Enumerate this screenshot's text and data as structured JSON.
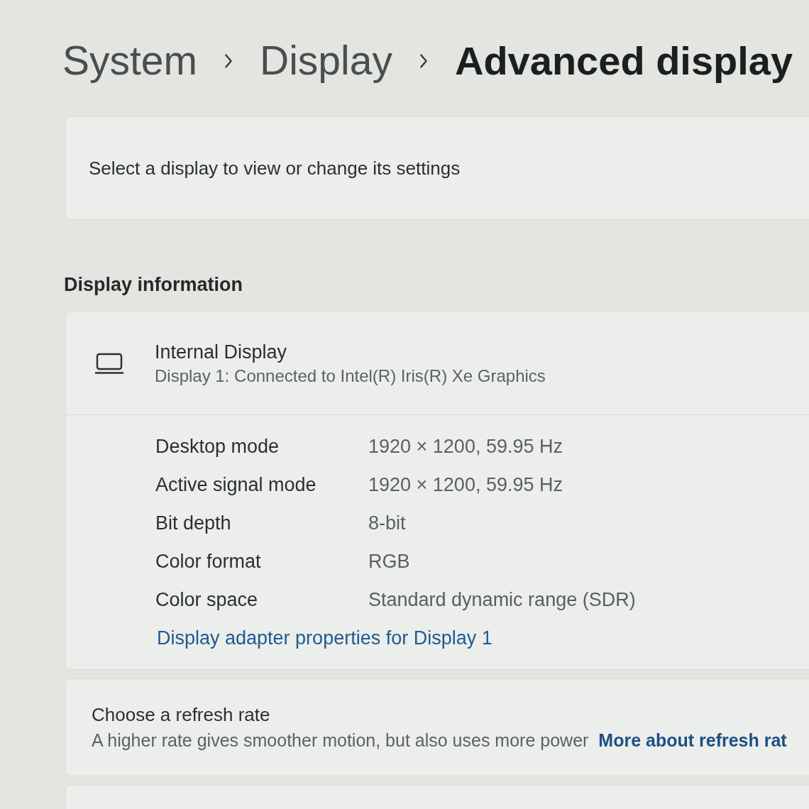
{
  "breadcrumb": [
    {
      "label": "System",
      "current": false
    },
    {
      "label": "Display",
      "current": false
    },
    {
      "label": "Advanced display",
      "current": true
    }
  ],
  "display_select": {
    "prompt": "Select a display to view or change its settings"
  },
  "display_information": {
    "heading": "Display information",
    "display": {
      "name": "Internal Display",
      "description": "Display 1: Connected to Intel(R) Iris(R) Xe Graphics"
    },
    "properties": [
      {
        "label": "Desktop mode",
        "value": "1920 × 1200, 59.95 Hz"
      },
      {
        "label": "Active signal mode",
        "value": "1920 × 1200, 59.95 Hz"
      },
      {
        "label": "Bit depth",
        "value": "8-bit"
      },
      {
        "label": "Color format",
        "value": "RGB"
      },
      {
        "label": "Color space",
        "value": "Standard dynamic range (SDR)"
      }
    ],
    "link": "Display adapter properties for Display 1"
  },
  "refresh_rate": {
    "title": "Choose a refresh rate",
    "description": "A higher rate gives smoother motion, but also uses more power",
    "link": "More about refresh rat"
  }
}
